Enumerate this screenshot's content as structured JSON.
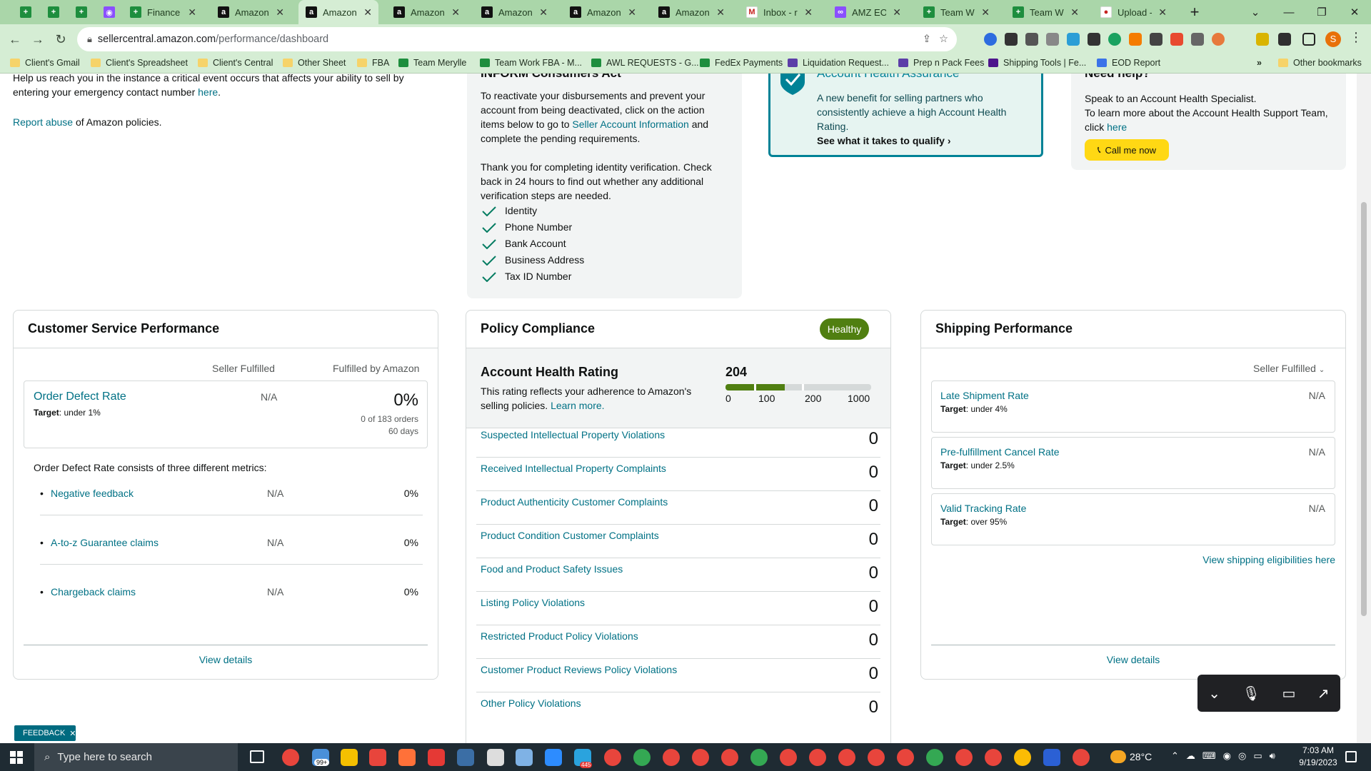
{
  "browser": {
    "tabs": [
      {
        "label": "",
        "icon": "sheets-icon"
      },
      {
        "label": "",
        "icon": "sheets-icon"
      },
      {
        "label": "",
        "icon": "sheets-icon"
      },
      {
        "label": "",
        "icon": "messenger-icon"
      },
      {
        "label": "Finance Sh",
        "icon": "sheets-icon"
      },
      {
        "label": "Amazon",
        "icon": "amazon-icon"
      },
      {
        "label": "Amazon",
        "icon": "amazon-icon",
        "active": true
      },
      {
        "label": "Amazon",
        "icon": "amazon-icon"
      },
      {
        "label": "Amazon",
        "icon": "amazon-icon"
      },
      {
        "label": "Amazon",
        "icon": "amazon-icon"
      },
      {
        "label": "Amazon",
        "icon": "amazon-icon"
      },
      {
        "label": "Inbox - rsg",
        "icon": "gmail-icon"
      },
      {
        "label": "AMZ EOD I",
        "icon": "link-icon"
      },
      {
        "label": "Team Worl",
        "icon": "sheets-icon"
      },
      {
        "label": "Team Worl",
        "icon": "sheets-icon"
      },
      {
        "label": "Upload - A",
        "icon": "pin-icon"
      }
    ],
    "url_domain": "sellercentral.amazon.com",
    "url_path": "/performance/dashboard",
    "bookmarks": [
      "Client's Gmail",
      "Client's Spreadsheet",
      "Client's Central",
      "Other Sheet",
      "FBA",
      "Team Merylle",
      "Team Work FBA - M...",
      "AWL REQUESTS - G...",
      "FedEx Payments",
      "Liquidation Request...",
      "Prep n Pack Fees",
      "Shipping Tools | Fe...",
      "EOD Report"
    ],
    "other_bookmarks": "Other bookmarks",
    "profile_initial": "S"
  },
  "top": {
    "emergency_text": "Help us reach you in the instance a critical event occurs that affects your ability to sell by entering your emergency contact number",
    "emergency_link": "here",
    "report_link": "Report abuse",
    "report_text": "of Amazon policies.",
    "inform_title": "INFORM Consumers Act",
    "inform_p1a": "To reactivate your disbursements and prevent your account from being deactivated, click on the action items below to go to",
    "inform_p1_link": "Seller Account Information",
    "inform_p1b": "and complete the pending requirements.",
    "inform_p2": "Thank you for completing identity verification. Check back in 24 hours to find out whether any additional verification steps are needed.",
    "inform_items": [
      "Identity",
      "Phone Number",
      "Bank Account",
      "Business Address",
      "Tax ID Number"
    ],
    "aha_title": "Account Health Assurance",
    "aha_text": "A new benefit for selling partners who consistently achieve a high Account Health Rating.",
    "aha_link": "See what it takes to qualify",
    "help_title": "Need help?",
    "help_text1": "Speak to an Account Health Specialist.",
    "help_text2": "To learn more about the Account Health Support Team, click",
    "help_link": "here",
    "help_button": "Call me now"
  },
  "csp": {
    "title": "Customer Service Performance",
    "col1": "Seller Fulfilled",
    "col2": "Fulfilled by Amazon",
    "odr_label": "Order Defect Rate",
    "odr_target_label": "Target",
    "odr_target": ": under 1%",
    "odr_seller": "N/A",
    "odr_fba": "0%",
    "odr_orders": "0 of 183 orders",
    "odr_days": "60 days",
    "metrics_intro": "Order Defect Rate consists of three different metrics:",
    "metrics": [
      {
        "label": "Negative feedback",
        "seller": "N/A",
        "fba": "0%"
      },
      {
        "label": "A-to-z Guarantee claims",
        "seller": "N/A",
        "fba": "0%"
      },
      {
        "label": "Chargeback claims",
        "seller": "N/A",
        "fba": "0%"
      }
    ],
    "view_details": "View details"
  },
  "policy": {
    "title": "Policy Compliance",
    "badge": "Healthy",
    "ahr_title": "Account Health Rating",
    "ahr_value": "204",
    "ahr_text": "This rating reflects your adherence to Amazon's selling policies.",
    "ahr_link": "Learn more.",
    "scale": [
      "0",
      "100",
      "200",
      "1000"
    ],
    "rating_fill_fraction": 0.204,
    "rows": [
      {
        "label": "Suspected Intellectual Property Violations",
        "count": "0"
      },
      {
        "label": "Received Intellectual Property Complaints",
        "count": "0"
      },
      {
        "label": "Product Authenticity Customer Complaints",
        "count": "0"
      },
      {
        "label": "Product Condition Customer Complaints",
        "count": "0"
      },
      {
        "label": "Food and Product Safety Issues",
        "count": "0"
      },
      {
        "label": "Listing Policy Violations",
        "count": "0"
      },
      {
        "label": "Restricted Product Policy Violations",
        "count": "0"
      },
      {
        "label": "Customer Product Reviews Policy Violations",
        "count": "0"
      },
      {
        "label": "Other Policy Violations",
        "count": "0"
      }
    ]
  },
  "shipping": {
    "title": "Shipping Performance",
    "dropdown": "Seller Fulfilled",
    "metrics": [
      {
        "label": "Late Shipment Rate",
        "target_label": "Target",
        "target": ": under 4%",
        "value": "N/A"
      },
      {
        "label": "Pre-fulfillment Cancel Rate",
        "target_label": "Target",
        "target": ": under 2.5%",
        "value": "N/A"
      },
      {
        "label": "Valid Tracking Rate",
        "target_label": "Target",
        "target": ": over 95%",
        "value": "N/A"
      }
    ],
    "eligibility_link": "View shipping eligibilities here",
    "view_details": "View details"
  },
  "feedback": "FEEDBACK",
  "taskbar": {
    "search_placeholder": "Type here to search",
    "badge": "99+",
    "telegram_count": "445",
    "temp": "28°C",
    "time": "7:03 AM",
    "date": "9/19/2023"
  }
}
